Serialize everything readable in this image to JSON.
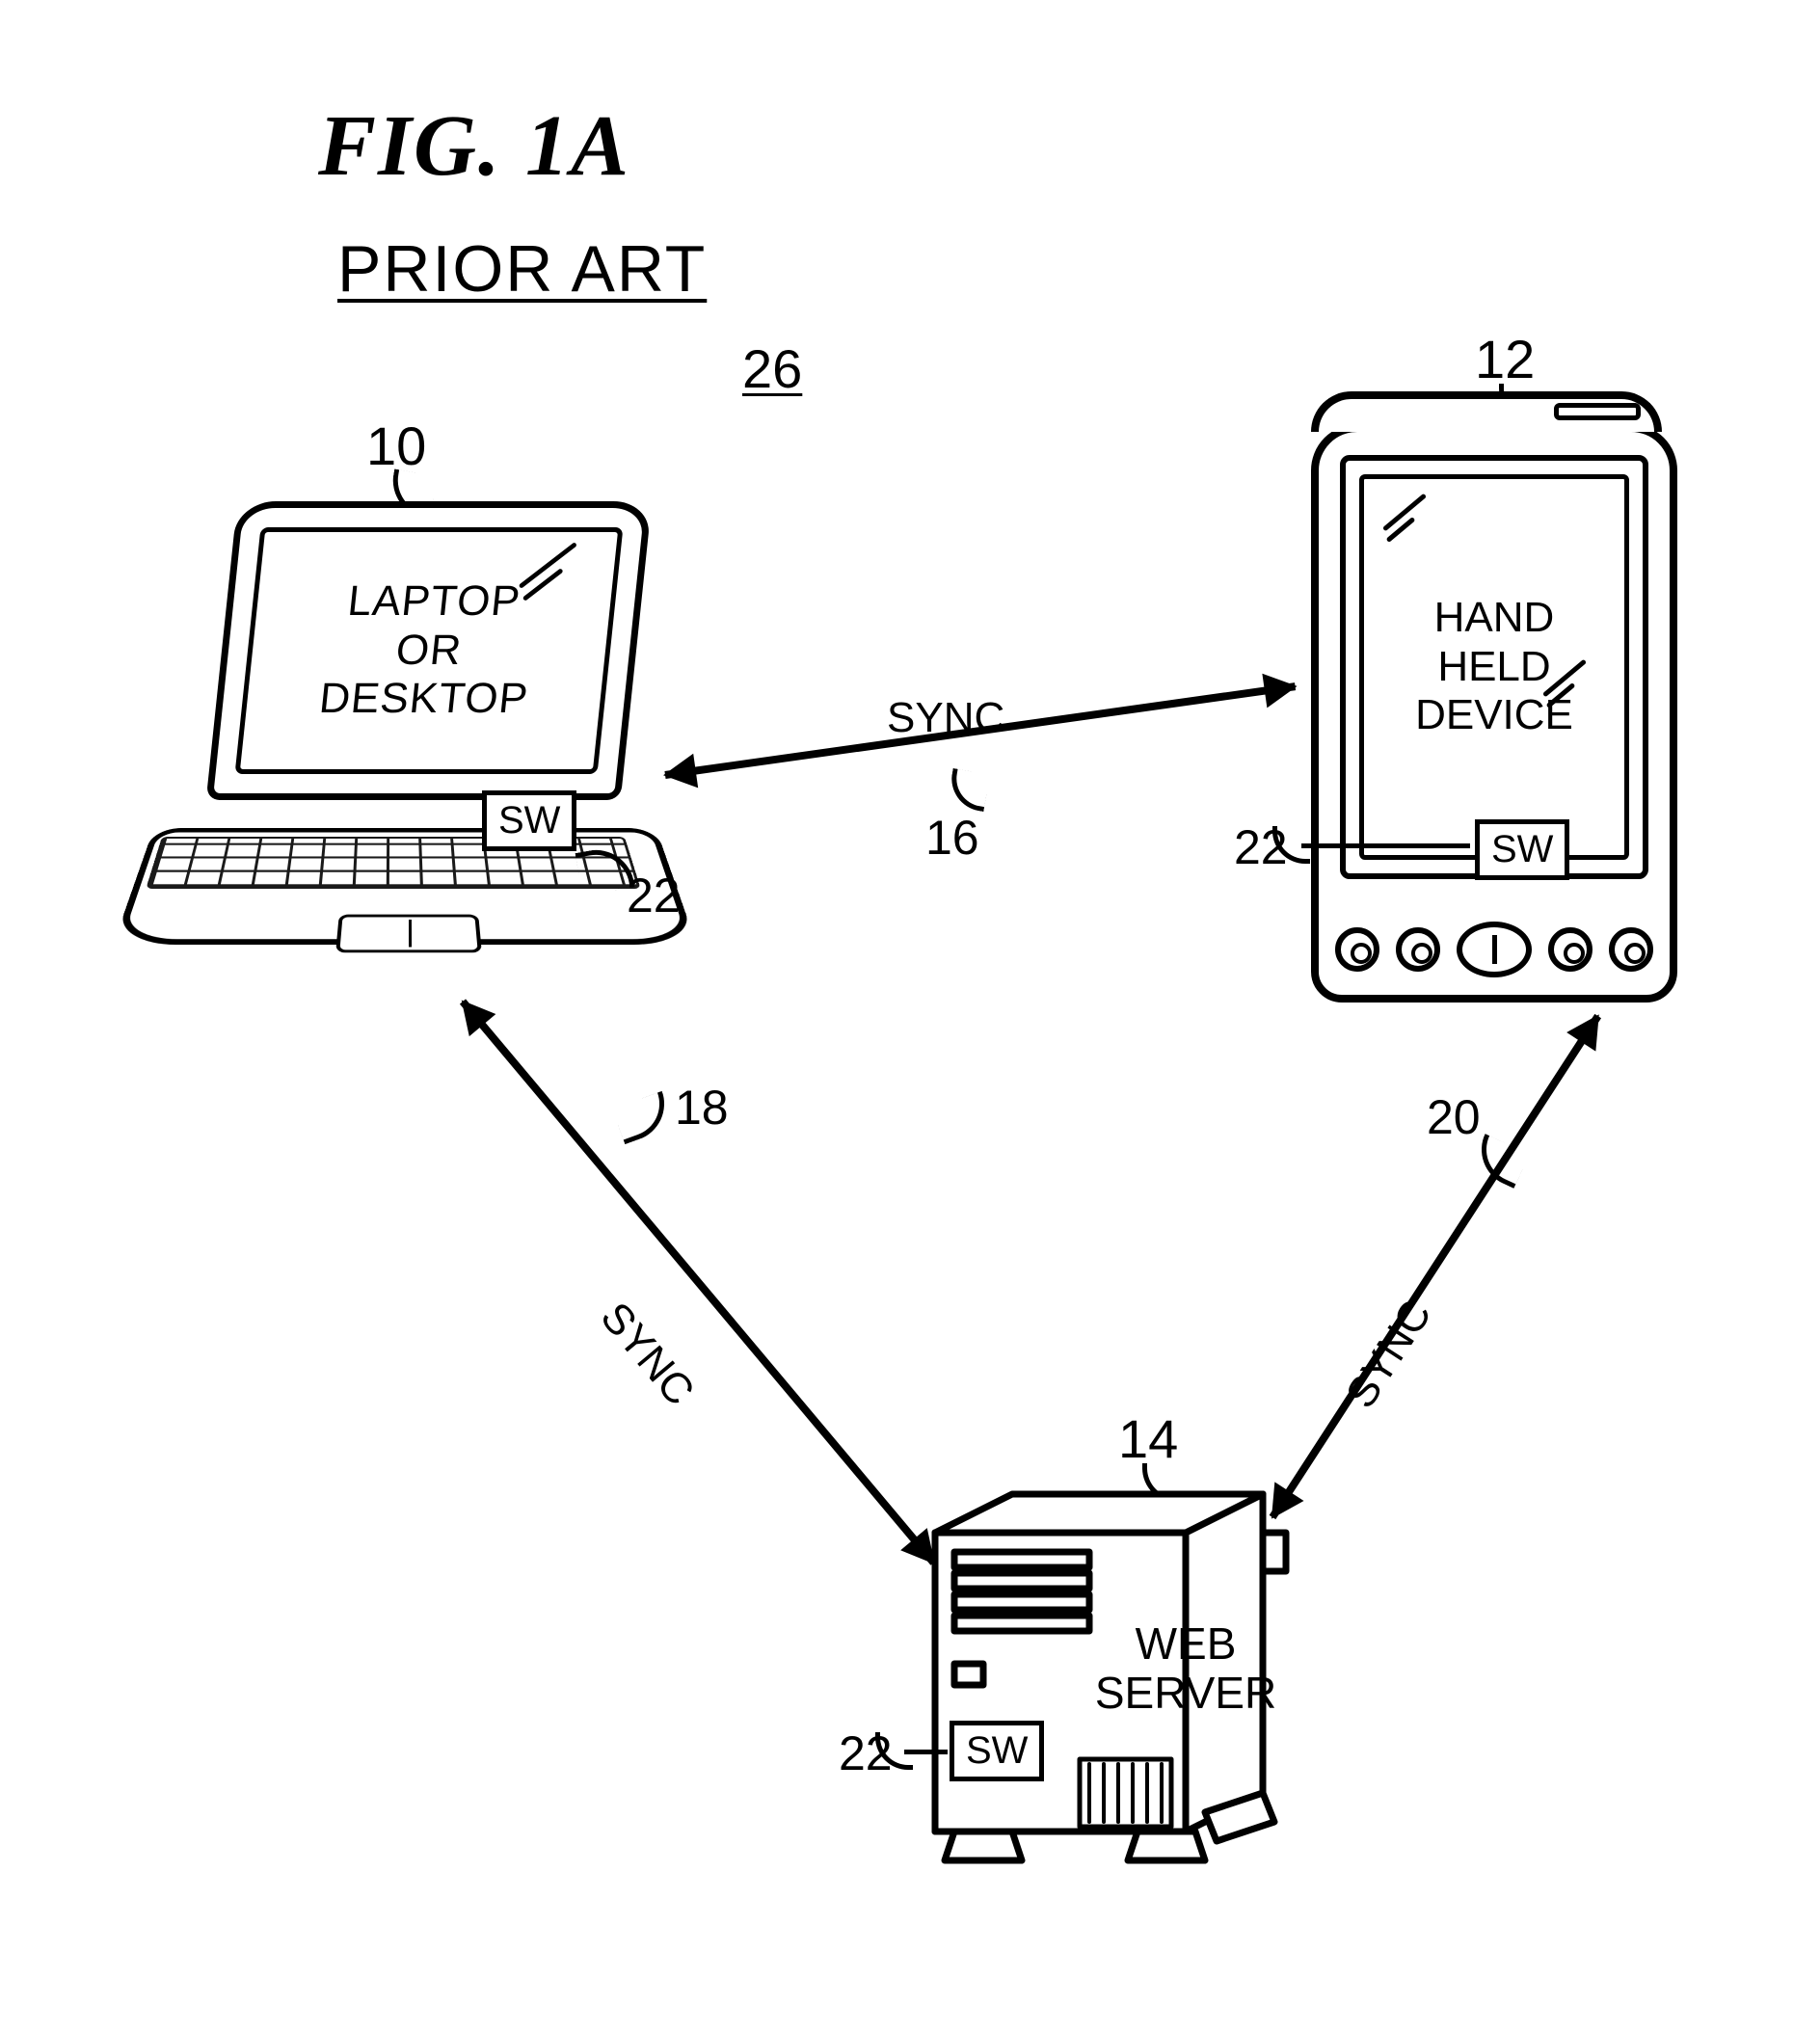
{
  "figure": {
    "title": "FIG. 1A",
    "subtitle": "PRIOR ART",
    "system_ref": "26"
  },
  "nodes": {
    "laptop": {
      "ref": "10",
      "label_l1": "LAPTOP",
      "label_l2": "OR",
      "label_l3": "DESKTOP"
    },
    "handheld": {
      "ref": "12",
      "label_l1": "HAND",
      "label_l2": "HELD",
      "label_l3": "DEVICE"
    },
    "server": {
      "ref": "14",
      "label_l1": "WEB",
      "label_l2": "SERVER"
    }
  },
  "sw": {
    "label": "SW",
    "ref": "22"
  },
  "links": {
    "laptop_handheld": {
      "ref": "16",
      "label": "SYNC"
    },
    "laptop_server": {
      "ref": "18",
      "label": "SYNC"
    },
    "handheld_server": {
      "ref": "20",
      "label": "SYNC"
    }
  }
}
